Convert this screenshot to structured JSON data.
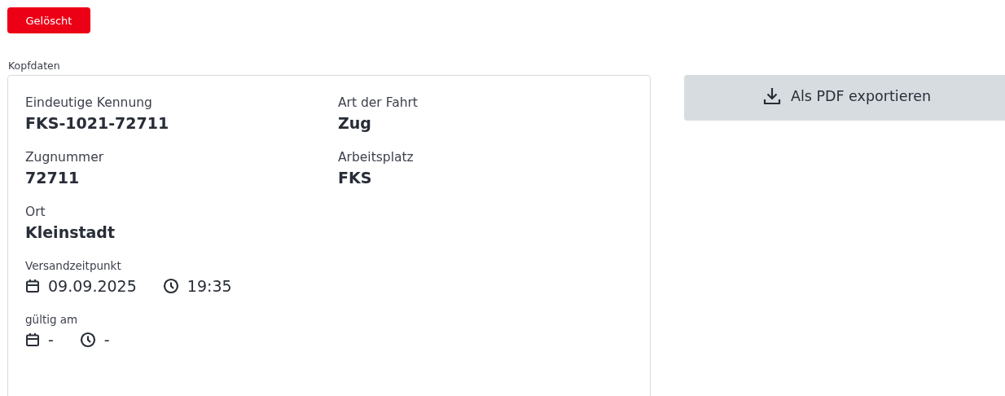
{
  "status_badge": "Gelöscht",
  "section_title": "Kopfdaten",
  "fields": [
    {
      "label": "Eindeutige Kennung",
      "value": "FKS-1021-72711"
    },
    {
      "label": "Art der Fahrt",
      "value": "Zug"
    },
    {
      "label": "Zugnummer",
      "value": "72711"
    },
    {
      "label": "Arbeitsplatz",
      "value": "FKS"
    },
    {
      "label": "Ort",
      "value": "Kleinstadt"
    }
  ],
  "timestamps": [
    {
      "label": "Versandzeitpunkt",
      "date": "09.09.2025",
      "time": "19:35"
    },
    {
      "label": "gültig am",
      "date": "-",
      "time": "-"
    }
  ],
  "export_button": "Als PDF exportieren"
}
